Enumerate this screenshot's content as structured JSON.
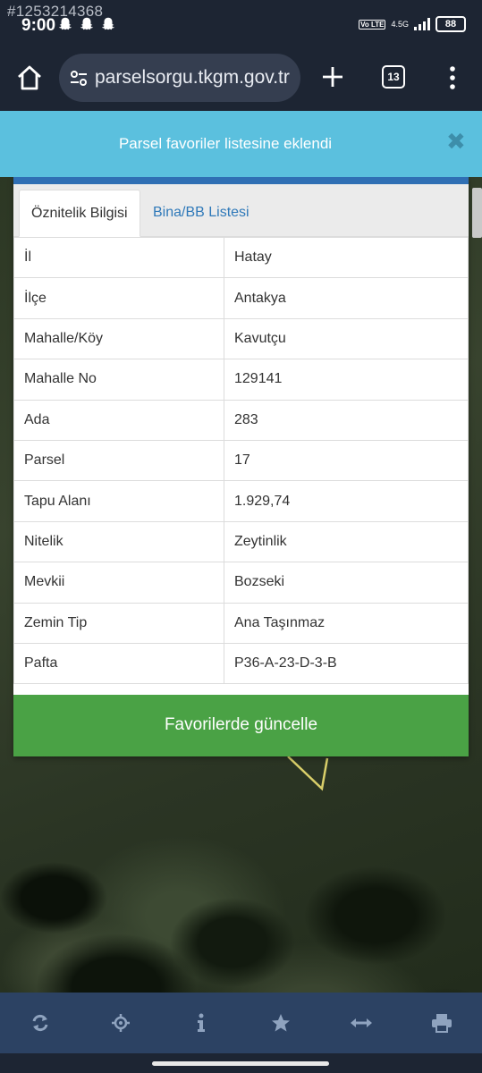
{
  "status_bar": {
    "watermark": "#1253214368",
    "time": "9:00",
    "volte": "Vo LTE",
    "network": "4.5G",
    "battery": "88"
  },
  "browser": {
    "url": "parselsorgu.tkgm.gov.tr",
    "tab_count": "13",
    "colors": {
      "toolbar": "#1d2533",
      "url_box": "#353e50"
    }
  },
  "toast": {
    "message": "Parsel favoriler listesine eklendi",
    "close_symbol": "✖",
    "color": "#5bc0de"
  },
  "panel": {
    "tabs": [
      {
        "label": "Öznitelik Bilgisi",
        "active": true
      },
      {
        "label": "Bina/BB Listesi",
        "active": false
      }
    ],
    "rows": [
      {
        "key": "İl",
        "value": "Hatay"
      },
      {
        "key": "İlçe",
        "value": "Antakya"
      },
      {
        "key": "Mahalle/Köy",
        "value": "Kavutçu"
      },
      {
        "key": "Mahalle No",
        "value": "129141"
      },
      {
        "key": "Ada",
        "value": "283"
      },
      {
        "key": "Parsel",
        "value": "17"
      },
      {
        "key": "Tapu Alanı",
        "value": "1.929,74"
      },
      {
        "key": "Nitelik",
        "value": "Zeytinlik"
      },
      {
        "key": "Mevkii",
        "value": "Bozseki"
      },
      {
        "key": "Zemin Tip",
        "value": "Ana Taşınmaz"
      },
      {
        "key": "Pafta",
        "value": "P36-A-23-D-3-B"
      }
    ],
    "update_button": "Favorilerde güncelle",
    "colors": {
      "header": "#2f6fb4",
      "button": "#4aa245"
    }
  },
  "bottom_nav": {
    "items": [
      "refresh-icon",
      "locate-icon",
      "info-icon",
      "star-icon",
      "measure-icon",
      "print-icon"
    ],
    "color": "#2c4263"
  }
}
